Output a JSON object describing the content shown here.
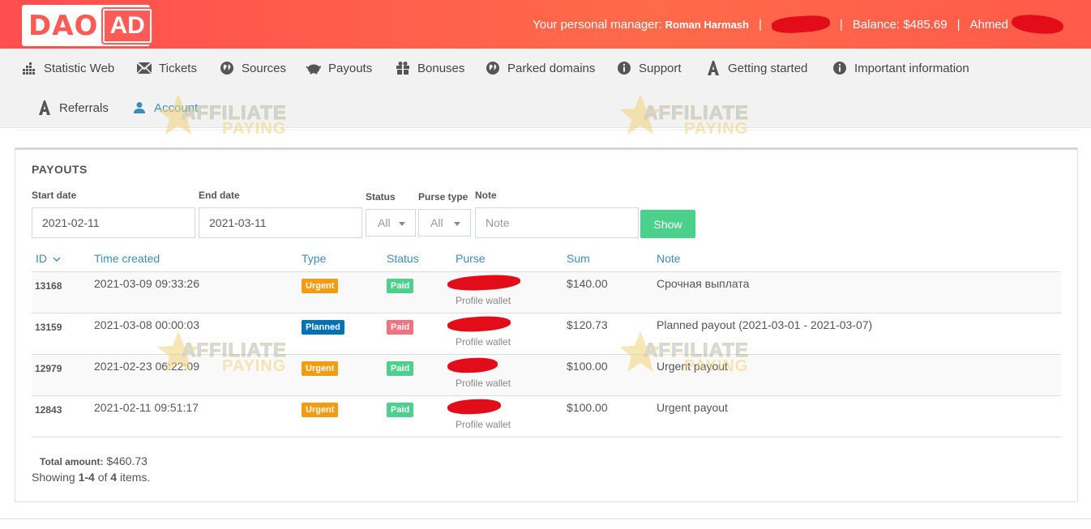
{
  "header": {
    "logo_left": "DAO",
    "logo_right": "AD",
    "manager_label": "Your personal manager:",
    "manager_name": "Roman Harmash",
    "separator": "|",
    "balance": "Balance: $485.69",
    "user": "Ahmed"
  },
  "nav": {
    "items": [
      {
        "label": "Statistic Web",
        "icon": "bar-chart-icon"
      },
      {
        "label": "Tickets",
        "icon": "envelope-icon"
      },
      {
        "label": "Sources",
        "icon": "globe-icon"
      },
      {
        "label": "Payouts",
        "icon": "piggy-bank-icon"
      },
      {
        "label": "Bonuses",
        "icon": "gift-icon"
      },
      {
        "label": "Parked domains",
        "icon": "globe-icon"
      },
      {
        "label": "Support",
        "icon": "info-icon"
      },
      {
        "label": "Getting started",
        "icon": "letter-a-icon"
      },
      {
        "label": "Important information",
        "icon": "info-icon"
      },
      {
        "label": "Referrals",
        "icon": "letter-a-icon"
      },
      {
        "label": "Account",
        "icon": "user-icon"
      }
    ]
  },
  "payouts": {
    "title": "PAYOUTS",
    "filters": {
      "start_label": "Start date",
      "start_value": "2021-02-11",
      "end_label": "End date",
      "end_value": "2021-03-11",
      "status_label": "Status",
      "status_value": "All",
      "purse_label": "Purse type",
      "purse_value": "All",
      "note_label": "Note",
      "note_placeholder": "Note",
      "show_button": "Show"
    },
    "columns": {
      "id": "ID",
      "time": "Time created",
      "type": "Type",
      "status": "Status",
      "purse": "Purse",
      "sum": "Sum",
      "note": "Note"
    },
    "rows": [
      {
        "id": "13168",
        "time": "2021-03-09 09:33:26",
        "type": "Urgent",
        "status": "Paid",
        "purse": "Profile wallet",
        "sum": "$140.00",
        "note": "Срочная выплата"
      },
      {
        "id": "13159",
        "time": "2021-03-08 00:00:03",
        "type": "Planned",
        "status": "Paid",
        "purse": "Profile wallet",
        "sum": "$120.73",
        "note": "Planned payout (2021-03-01 - 2021-03-07)"
      },
      {
        "id": "12979",
        "time": "2021-02-23 06:22:09",
        "type": "Urgent",
        "status": "Paid",
        "purse": "Profile wallet",
        "sum": "$100.00",
        "note": "Urgent payout"
      },
      {
        "id": "12843",
        "time": "2021-02-11 09:51:17",
        "type": "Urgent",
        "status": "Paid",
        "purse": "Profile wallet",
        "sum": "$100.00",
        "note": "Urgent payout"
      }
    ],
    "total_label": "Total amount:",
    "total_value": "$460.73",
    "showing_prefix": "Showing",
    "showing_range": "1-4",
    "showing_of": "of",
    "showing_count": "4",
    "showing_suffix": "items."
  },
  "watermark": {
    "line1": "AFFILIATE",
    "line2": "PAYING"
  },
  "colors": {
    "header": "#ff5a4a",
    "link": "#3c8dbc",
    "urgent": "#f39c12",
    "planned": "#0073b7",
    "paid": "#4bd18c",
    "show_button": "#4bd18c"
  }
}
